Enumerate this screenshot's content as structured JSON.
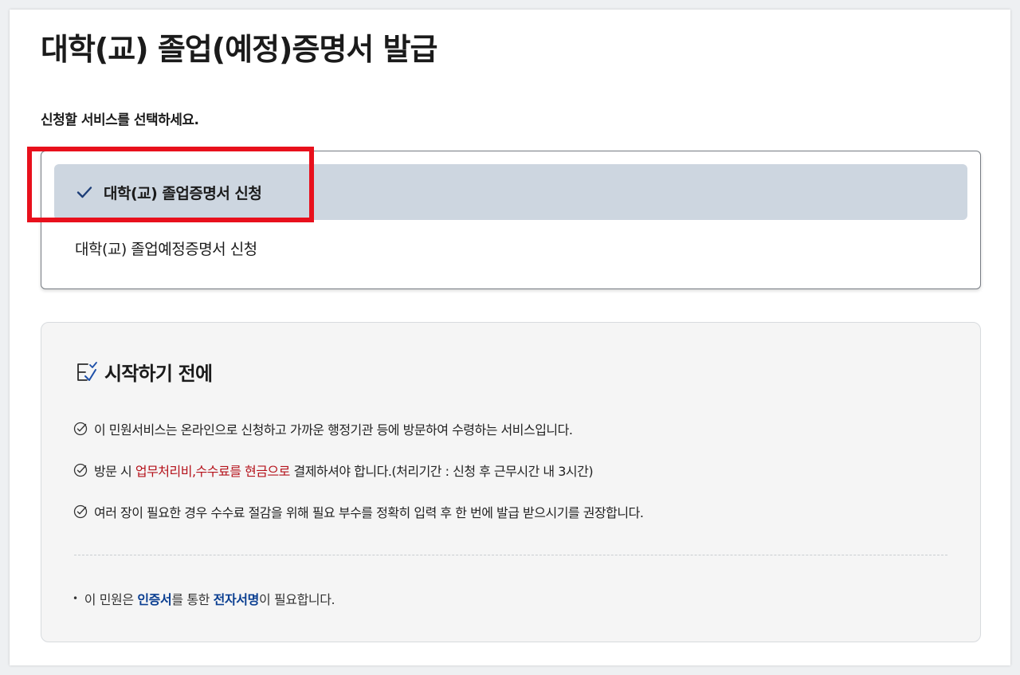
{
  "page": {
    "title": "대학(교) 졸업(예정)증명서 발급",
    "subtitle": "신청할 서비스를 선택하세요."
  },
  "options": [
    {
      "label": "대학(교) 졸업증명서 신청",
      "selected": true
    },
    {
      "label": "대학(교) 졸업예정증명서 신청",
      "selected": false
    }
  ],
  "info": {
    "heading": "시작하기 전에",
    "notes": [
      {
        "text": "이 민원서비스는 온라인으로 신청하고 가까운 행정기관 등에 방문하여 수령하는 서비스입니다."
      },
      {
        "prefix": "방문 시 ",
        "highlight": "업무처리비,수수료를 현금으로",
        "suffix": " 결제하셔야 합니다.(처리기간 : 신청 후 근무시간 내 3시간)"
      },
      {
        "text": "여러 장이 필요한 경우 수수료 절감을 위해 필요 부수를 정확히 입력 후 한 번에 발급 받으시기를 권장합니다."
      }
    ],
    "footer": {
      "prefix": "이 민원은 ",
      "strong1": "인증서",
      "middle": "를 통한 ",
      "strong2": "전자서명",
      "suffix": "이 필요합니다."
    }
  },
  "colors": {
    "selected_bg": "#cdd6e0",
    "highlight_box": "#e8101c",
    "red_text": "#b5121b",
    "blue_text": "#0b3f91",
    "check_icon": "#1d3e78"
  },
  "icons": {
    "selected_option": "checkmark-icon",
    "section_heading": "checklist-icon",
    "note_bullet": "circle-check-icon"
  }
}
